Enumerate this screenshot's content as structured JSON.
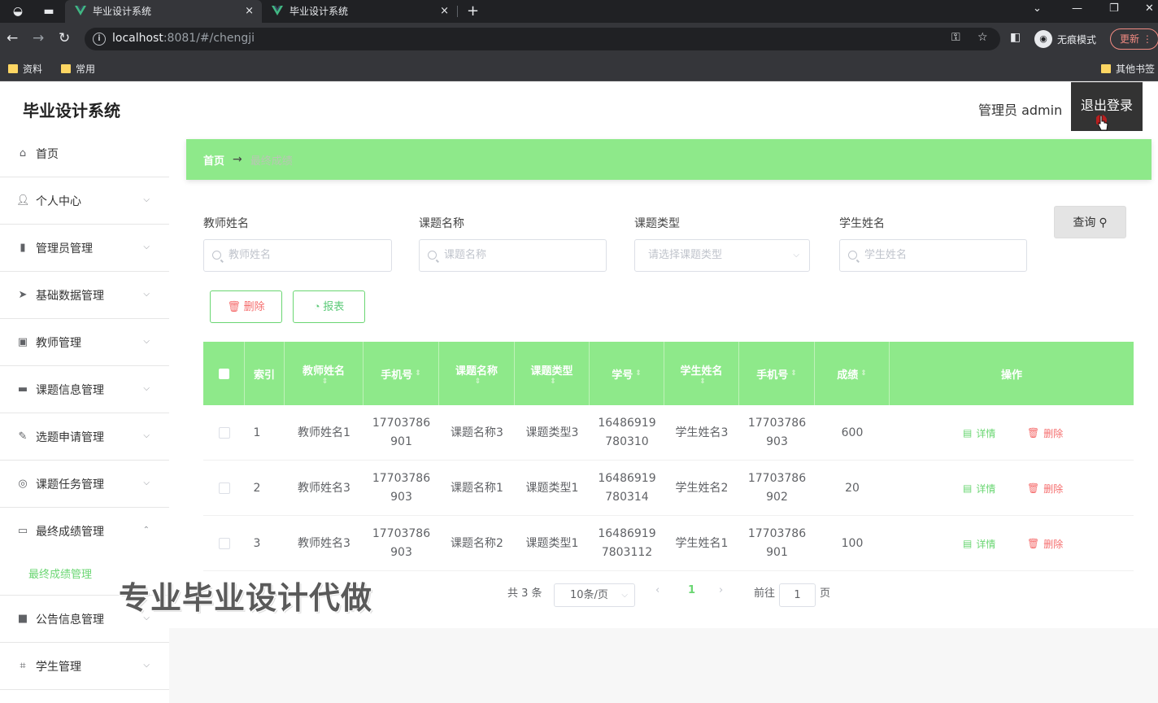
{
  "browser": {
    "tabs": [
      {
        "title": "毕业设计系统",
        "close": "×"
      },
      {
        "title": "毕业设计系统",
        "close": "×"
      }
    ],
    "new_tab": "+",
    "url_host": "localhost",
    "url_rest": ":8081/#/chengji",
    "incognito_label": "无痕模式",
    "update_label": "更新",
    "bookmarks": [
      "资料",
      "常用"
    ],
    "other_bookmarks": "其他书签"
  },
  "app": {
    "title": "毕业设计系统",
    "admin_label": "管理员 admin",
    "logout_label": "退出登录"
  },
  "sidebar": {
    "items": [
      {
        "label": "首页",
        "icon": "home-icon"
      },
      {
        "label": "个人中心",
        "icon": "user-icon"
      },
      {
        "label": "管理员管理",
        "icon": "bar-chart-icon"
      },
      {
        "label": "基础数据管理",
        "icon": "send-icon"
      },
      {
        "label": "教师管理",
        "icon": "clipboard-icon"
      },
      {
        "label": "课题信息管理",
        "icon": "chat-icon"
      },
      {
        "label": "选题申请管理",
        "icon": "edit-icon"
      },
      {
        "label": "课题任务管理",
        "icon": "compass-icon"
      },
      {
        "label": "最终成绩管理",
        "icon": "monitor-icon"
      },
      {
        "label": "公告信息管理",
        "icon": "video-icon"
      },
      {
        "label": "学生管理",
        "icon": "crop-icon"
      }
    ],
    "submenu_active": "最终成绩管理"
  },
  "breadcrumb": {
    "home": "首页",
    "arrow": "→",
    "current": "最终成绩"
  },
  "filters": {
    "teacher": {
      "label": "教师姓名",
      "placeholder": "教师姓名"
    },
    "topic": {
      "label": "课题名称",
      "placeholder": "课题名称"
    },
    "type": {
      "label": "课题类型",
      "placeholder": "请选择课题类型"
    },
    "student": {
      "label": "学生姓名",
      "placeholder": "学生姓名"
    },
    "query_label": "查询"
  },
  "actions": {
    "delete_label": "删除",
    "report_label": "报表"
  },
  "table": {
    "headers": {
      "index": "索引",
      "teacher": "教师姓名",
      "phone1": "手机号",
      "topic": "课题名称",
      "type": "课题类型",
      "student_no": "学号",
      "student": "学生姓名",
      "phone2": "手机号",
      "score": "成绩",
      "operation": "操作"
    },
    "rows": [
      {
        "index": "1",
        "teacher": "教师姓名1",
        "phone1_a": "17703786",
        "phone1_b": "901",
        "topic": "课题名称3",
        "type": "课题类型3",
        "no_a": "16486919",
        "no_b": "780310",
        "student": "学生姓名3",
        "phone2_a": "17703786",
        "phone2_b": "903",
        "score": "600"
      },
      {
        "index": "2",
        "teacher": "教师姓名3",
        "phone1_a": "17703786",
        "phone1_b": "903",
        "topic": "课题名称1",
        "type": "课题类型1",
        "no_a": "16486919",
        "no_b": "780314",
        "student": "学生姓名2",
        "phone2_a": "17703786",
        "phone2_b": "902",
        "score": "20"
      },
      {
        "index": "3",
        "teacher": "教师姓名3",
        "phone1_a": "17703786",
        "phone1_b": "903",
        "topic": "课题名称2",
        "type": "课题类型1",
        "no_a": "16486919",
        "no_b": "7803112",
        "student": "学生姓名1",
        "phone2_a": "17703786",
        "phone2_b": "901",
        "score": "100"
      }
    ],
    "detail_label": "详情",
    "remove_label": "删除"
  },
  "pagination": {
    "total": "共 3 条",
    "page_size": "10条/页",
    "current_page": "1",
    "goto_label": "前往",
    "goto_value": "1",
    "page_unit": "页"
  },
  "watermark": "专业毕业设计代做",
  "colors": {
    "accent_green": "#8ee98a",
    "link_green": "#6ad672",
    "danger_red": "#f56c6c",
    "logout_bg": "#333333"
  }
}
